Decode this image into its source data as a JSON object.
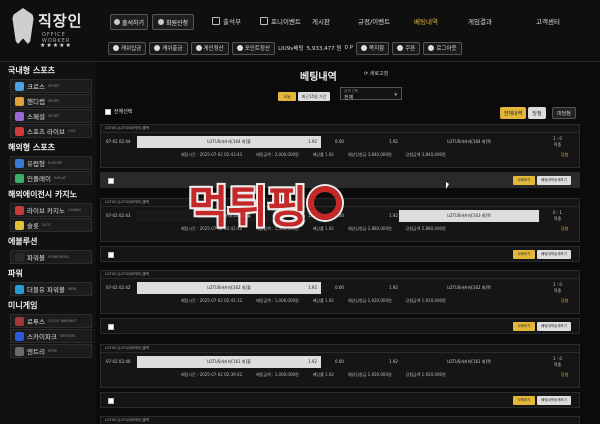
{
  "logo": {
    "name": "직장인",
    "sub": "OFFICE WORKER",
    "stars": "★★★★★"
  },
  "header": {
    "btn_signup": "출석하기",
    "btn_signin": "회원신청",
    "nav": [
      {
        "label": "출석부",
        "icon": "calendar-icon",
        "active": false
      },
      {
        "label": "포니이벤트",
        "icon": "gift-icon",
        "active": false
      },
      {
        "label": "게시판",
        "icon": "board-icon",
        "active": false
      },
      {
        "label": "규정/이벤트",
        "icon": "list-icon",
        "active": false
      },
      {
        "label": "베팅내역",
        "icon": "receipt-icon",
        "active": true
      },
      {
        "label": "게임결과",
        "icon": "trophy-icon",
        "active": false
      },
      {
        "label": "고객센터",
        "icon": "headset-icon",
        "active": false
      }
    ],
    "row2": {
      "deposit": "캐쉬입금",
      "withdraw": "캐쉬출금",
      "pass": "게인정산",
      "point": "포인트정산",
      "user": "LIU9v배팅",
      "money": "5,933,477 원",
      "point_val": "0 P",
      "msg": "쪽지함",
      "coupon": "쿠폰",
      "logout": "로그아웃"
    }
  },
  "sidebar": {
    "sections": [
      {
        "title": "국내형 스포츠",
        "items": [
          {
            "label": "크로스",
            "tag": "SPORT",
            "icon": "cross-icon",
            "color": "#4aa3e0"
          },
          {
            "label": "핸디캡",
            "tag": "SPORT",
            "icon": "handicap-icon",
            "color": "#e0a23a"
          },
          {
            "label": "스페셜",
            "tag": "SPORT",
            "icon": "special-icon",
            "color": "#9a6ad6"
          },
          {
            "label": "스포츠 라이브",
            "tag": "LIVE",
            "icon": "live-icon",
            "color": "#d03a3a"
          }
        ]
      },
      {
        "title": "해외형 스포츠",
        "items": [
          {
            "label": "유럽형",
            "tag": "EUROPE",
            "icon": "europe-icon",
            "color": "#3a7ad6"
          },
          {
            "label": "인플레이",
            "tag": "INPLAY",
            "icon": "inplay-icon",
            "color": "#3ab06a"
          }
        ]
      },
      {
        "title": "해외에이전시 카지노",
        "items": [
          {
            "label": "라이브 카지노",
            "tag": "CASINO",
            "icon": "casino-icon",
            "color": "#c83a3a"
          },
          {
            "label": "슬롯",
            "tag": "SLOT",
            "icon": "slot-icon",
            "color": "#e0c23a"
          }
        ]
      },
      {
        "title": "에볼루션",
        "items": [
          {
            "label": "파워볼",
            "tag": "POWERBALL",
            "icon": "powerball-icon",
            "color": "#2a2a2a"
          }
        ]
      },
      {
        "title": "파워",
        "items": [
          {
            "label": "더블유 파워볼",
            "tag": "WPB",
            "icon": "wpowerball-icon",
            "color": "#2a9ad6"
          }
        ]
      },
      {
        "title": "미니게임",
        "items": [
          {
            "label": "로투스",
            "tag": "LOTUS BAKARAT",
            "icon": "lotus-icon",
            "color": "#a03a3a"
          },
          {
            "label": "스카이파크",
            "tag": "SKYPARK",
            "icon": "skypark-icon",
            "color": "#2a5ad6"
          },
          {
            "label": "엔트리",
            "tag": "NTRY",
            "icon": "ntry-icon",
            "color": "#6a6a6a"
          }
        ]
      }
    ]
  },
  "main": {
    "title": "베팅내역",
    "refresh": "새로고침",
    "filter_today": "오늘",
    "filter_period": "최근15일 기간",
    "select_label": "검색 선택",
    "select_value": "전체",
    "all_select": "전체선택",
    "tab_winlose": "전체내역",
    "tab_win": "당첨",
    "tab_lose": "미당첨",
    "cards": [
      {
        "title": "LOTUS [LOTUS바카라] 홀짝",
        "date": "07-02 02:44",
        "home": "LOTUS바카라[164 회]홀",
        "home_odd": "1.92",
        "mid": "0.00",
        "mid2": "1.92",
        "away": "LOTUS바카라[164 회]짝",
        "score": "1 : 0",
        "score2": "적중",
        "bet_time": "베팅시간 : 2025-07-02 02:43:43",
        "bet_amount": "베팅금액 : 2,000,000원",
        "odds": "배당률 1.92",
        "expected": "예상당첨금 3,840,000원",
        "win": "당첨금액 3,840,000원",
        "result": "당첨",
        "highlight": "home"
      },
      {
        "title": "LOTUS [LOTUS바카라] 홀짝",
        "date": "07-02 02:43",
        "home": "LOTUS바카라[163 회]홀",
        "home_odd": "1.92",
        "mid": "0.00",
        "mid2": "1.92",
        "away": "LOTUS바카라[163 회]짝",
        "score": "0 : 1",
        "score2": "적중",
        "bet_time": "베팅시간 : 2025-07-02 02:42:42",
        "bet_amount": "베팅금액 : 1,500,000원",
        "odds": "배당률 1.92",
        "expected": "예상당첨금 2,880,000원",
        "win": "당첨금액 2,880,000원",
        "result": "당첨",
        "highlight": "away"
      },
      {
        "title": "LOTUS [LOTUS바카라] 홀짝",
        "date": "07-02 02:42",
        "home": "LOTUS바카라[162 회]홀",
        "home_odd": "1.92",
        "mid": "0.00",
        "mid2": "1.92",
        "away": "LOTUS바카라[162 회]짝",
        "score": "1 : 0",
        "score2": "적중",
        "bet_time": "베팅시간 : 2025-07-02 02:41:12",
        "bet_amount": "베팅금액 : 1,000,000원",
        "odds": "배당률 1.92",
        "expected": "예상당첨금 1,920,000원",
        "win": "당첨금액 1,920,000원",
        "result": "당첨",
        "highlight": "home"
      },
      {
        "title": "LOTUS [LOTUS바카라] 홀짝",
        "date": "07-02 02:40",
        "home": "LOTUS바카라[161 회]홀",
        "home_odd": "1.92",
        "mid": "0.00",
        "mid2": "1.92",
        "away": "LOTUS바카라[161 회]짝",
        "score": "1 : 0",
        "score2": "적중",
        "bet_time": "베팅시간 : 2025-07-02 02:39:42",
        "bet_amount": "베팅금액 : 1,000,000원",
        "odds": "배당률 1.92",
        "expected": "예상당첨금 1,920,000원",
        "win": "당첨금액 1,920,000원",
        "result": "당첨",
        "highlight": "home"
      }
    ],
    "btn_cancel": "삭제하기",
    "btn_detail": "베팅내역상세보기",
    "last_card_title": "LOTUS [LOTUS바카라] 홀짝"
  },
  "watermark": "먹튀핑"
}
